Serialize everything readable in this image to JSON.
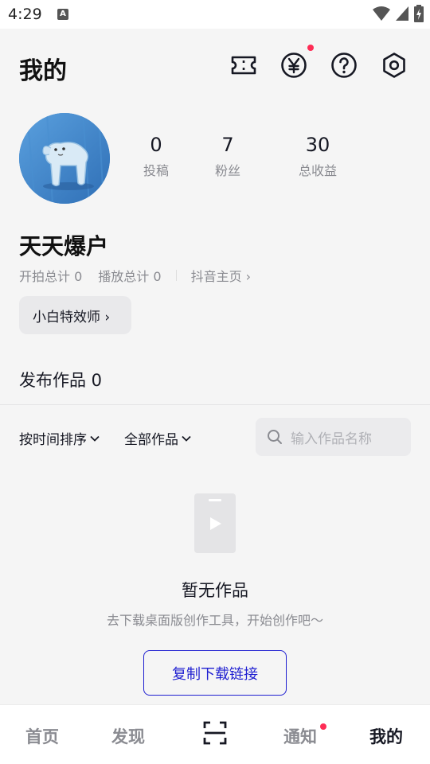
{
  "status_bar": {
    "time": "4:29",
    "a_label": "A"
  },
  "header": {
    "title": "我的",
    "icons": [
      "ticket-icon",
      "yen-coin-icon",
      "help-icon",
      "settings-icon"
    ]
  },
  "profile": {
    "stats": [
      {
        "value": "0",
        "label": "投稿"
      },
      {
        "value": "7",
        "label": "粉丝"
      },
      {
        "value": "30",
        "label": "总收益"
      }
    ],
    "username": "天天爆户",
    "open_total": "开拍总计 0",
    "play_total": "播放总计 0",
    "douyin_home": "抖音主页 ›",
    "badge": "小白特效师 ›"
  },
  "works": {
    "title": "发布作品 0",
    "sort_filter": "按时间排序",
    "type_filter": "全部作品",
    "search_placeholder": "输入作品名称",
    "empty_title": "暂无作品",
    "empty_subtitle": "去下载桌面版创作工具，开始创作吧～",
    "copy_button": "复制下载链接"
  },
  "tabs": [
    {
      "label": "首页"
    },
    {
      "label": "发现"
    },
    {
      "label": "通知"
    },
    {
      "label": "我的"
    }
  ],
  "colors": {
    "accent": "#1f1fd1",
    "notification_dot": "#fe2c55"
  }
}
